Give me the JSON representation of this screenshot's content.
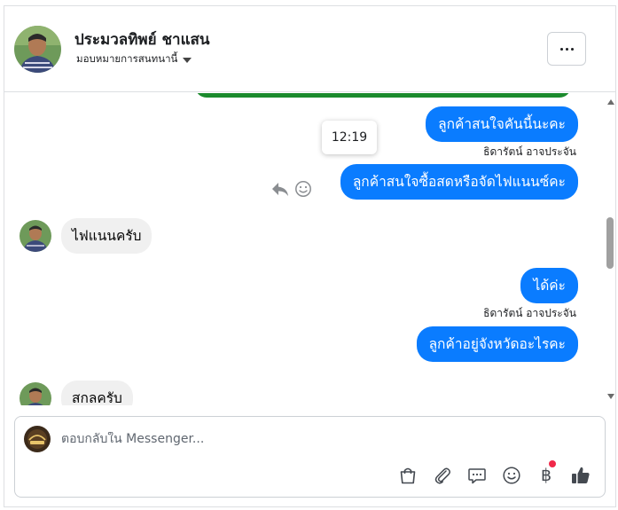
{
  "header": {
    "contact_name": "ประมวลทิพย์ ชาแสน",
    "assign_label": "มอบหมายการสนทนานี้",
    "more_label": "..."
  },
  "messages": {
    "m1_text": "ลูกค้าสนใจคันนี้นะคะ",
    "m1_sender": "ธิดารัตน์ อาจประจัน",
    "tooltip_time": "12:19",
    "m2_text": "ลูกค้าสนใจซื้อสดหรือจัดไฟแนนซ์คะ",
    "m3_text": "ไฟแนนครับ",
    "m4_text": "ได้ค่ะ",
    "m4_sender": "ธิดารัตน์ อาจประจัน",
    "m5_text": "ลูกค้าอยู่จังหวัดอะไรคะ",
    "m6_text": "สกลครับ"
  },
  "composer": {
    "placeholder": "ตอบกลับใน Messenger..."
  },
  "icons": {
    "baht_symbol": "฿"
  },
  "colors": {
    "outgoing_bubble": "#0a7cff",
    "incoming_bubble": "#f0f0f0",
    "notification_dot": "#f02849"
  }
}
